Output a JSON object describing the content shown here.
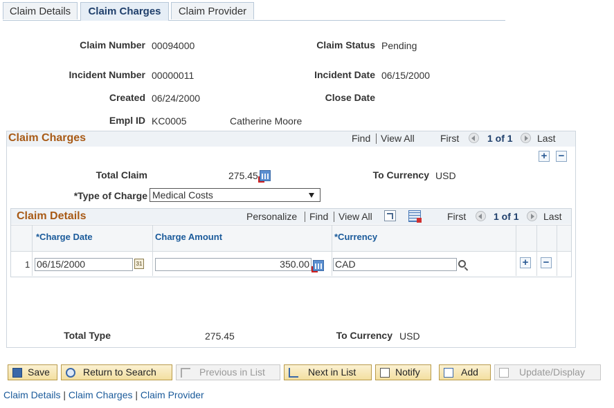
{
  "tabs": [
    "Claim Details",
    "Claim Charges",
    "Claim Provider"
  ],
  "header": {
    "claim_number_label": "Claim Number",
    "claim_number": "00094000",
    "claim_status_label": "Claim Status",
    "claim_status": "Pending",
    "incident_number_label": "Incident Number",
    "incident_number": "00000011",
    "incident_date_label": "Incident Date",
    "incident_date": "06/15/2000",
    "created_label": "Created",
    "created": "06/24/2000",
    "close_date_label": "Close Date",
    "close_date": "",
    "empl_id_label": "Empl ID",
    "empl_id": "KC0005",
    "empl_name": "Catherine Moore"
  },
  "charges": {
    "title": "Claim Charges",
    "find": "Find",
    "view_all": "View All",
    "first": "First",
    "pager": "1 of 1",
    "last": "Last",
    "total_claim_label": "Total Claim",
    "total_claim": "275.45",
    "to_currency_label": "To Currency",
    "to_currency": "USD",
    "type_label": "*Type of Charge",
    "type_value": "Medical Costs",
    "total_type_label": "Total Type",
    "total_type": "275.45",
    "to_currency2_label": "To Currency",
    "to_currency2": "USD"
  },
  "details": {
    "title": "Claim Details",
    "personalize": "Personalize",
    "find": "Find",
    "view_all": "View All",
    "first": "First",
    "pager": "1 of 1",
    "last": "Last",
    "columns": [
      "*Charge Date",
      "Charge Amount",
      "*Currency"
    ],
    "rows": [
      {
        "num": "1",
        "charge_date": "06/15/2000",
        "charge_amount": "350.00",
        "currency": "CAD"
      }
    ]
  },
  "buttons": {
    "save": "Save",
    "return": "Return to Search",
    "previous": "Previous in List",
    "next": "Next in List",
    "notify": "Notify",
    "add": "Add",
    "update": "Update/Display"
  },
  "footer_links": [
    "Claim Details",
    "Claim Charges",
    "Claim Provider"
  ],
  "footer_sep": "|",
  "colors": {
    "accent_title": "#a85a16",
    "link": "#1a5a9a"
  }
}
